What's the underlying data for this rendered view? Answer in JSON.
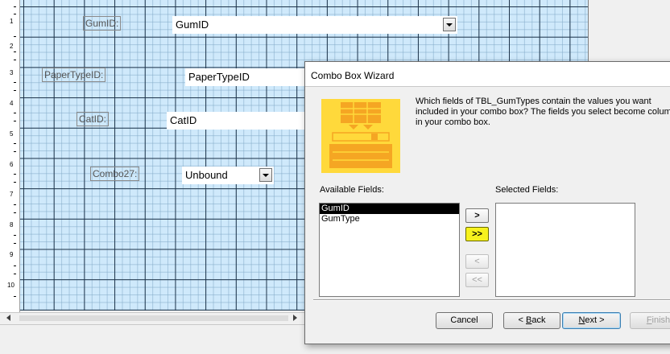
{
  "form": {
    "ruler_numbers": [
      "1",
      "2",
      "3",
      "4",
      "5",
      "6",
      "7",
      "8",
      "9",
      "10"
    ],
    "controls": [
      {
        "label": "GumID:",
        "value": "GumID",
        "dropdown": true
      },
      {
        "label": "PaperTypeID:",
        "value": "PaperTypeID",
        "dropdown": false
      },
      {
        "label": "CatID:",
        "value": "CatID",
        "dropdown": false
      },
      {
        "label": "Combo27:",
        "value": "Unbound",
        "dropdown": true
      }
    ]
  },
  "wizard": {
    "title": "Combo Box Wizard",
    "prompt": "Which fields of TBL_GumTypes contain the values you want\nincluded in your combo box? The fields you select become columns\nin your combo box.",
    "available_label": "Available Fields:",
    "selected_label": "Selected Fields:",
    "available_fields": [
      "GumID",
      "GumType"
    ],
    "selected_fields": [],
    "move_buttons": {
      "add_one": ">",
      "add_all": ">>",
      "remove_one": "<",
      "remove_all": "<<"
    },
    "buttons": {
      "cancel": "Cancel",
      "back_mnemonic": "B",
      "back_rest": "ack",
      "back_prefix": "< ",
      "next_mnemonic": "N",
      "next_rest": "ext >",
      "finish_mnemonic": "F",
      "finish_rest": "inish"
    },
    "colors": {
      "icon_bg": "#ffd93b",
      "icon_table": "#f5a623",
      "add_all_highlight": "#f7f21e"
    }
  }
}
